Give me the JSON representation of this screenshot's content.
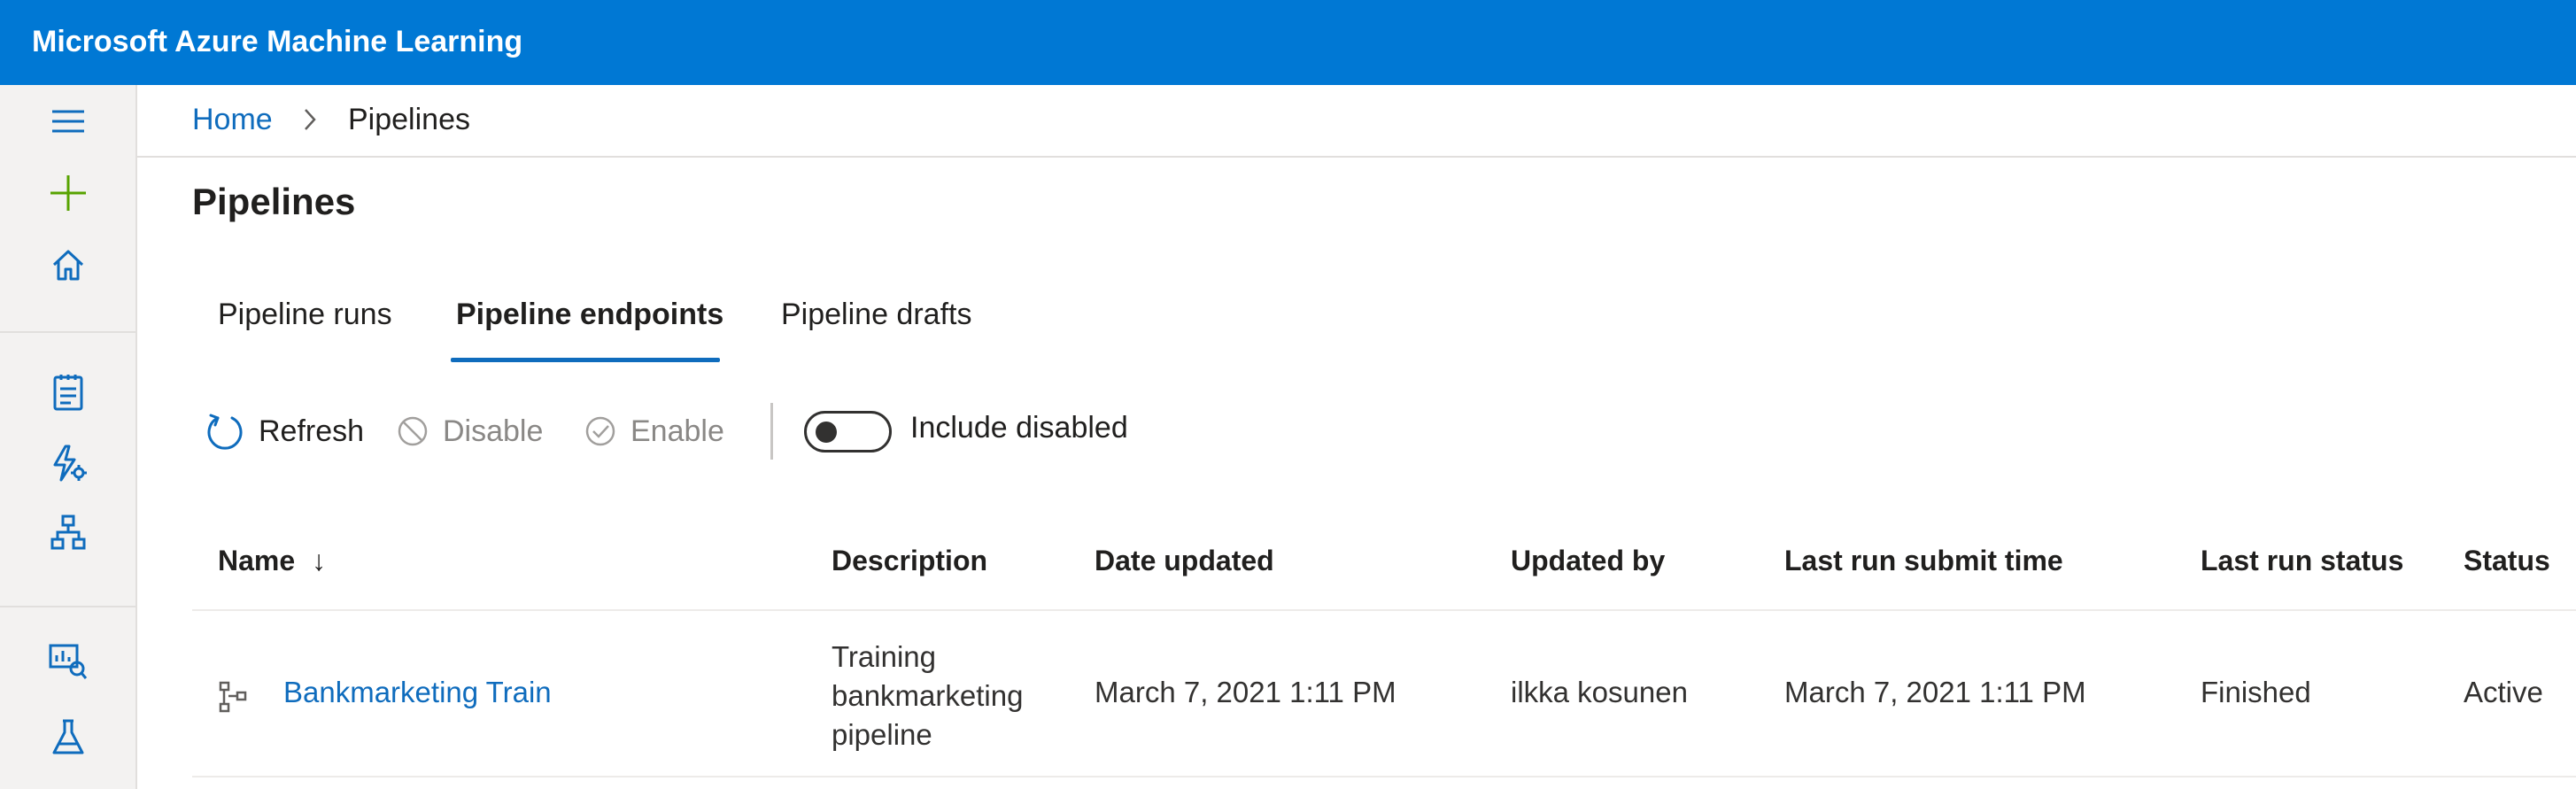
{
  "app": {
    "title": "Microsoft Azure Machine Learning"
  },
  "breadcrumb": {
    "home": "Home",
    "current": "Pipelines"
  },
  "page": {
    "title": "Pipelines"
  },
  "tabs": [
    {
      "label": "Pipeline runs",
      "selected": false
    },
    {
      "label": "Pipeline endpoints",
      "selected": true
    },
    {
      "label": "Pipeline drafts",
      "selected": false
    }
  ],
  "toolbar": {
    "refresh": "Refresh",
    "disable": "Disable",
    "enable": "Enable",
    "include_disabled": "Include disabled",
    "include_disabled_on": false
  },
  "table": {
    "columns": [
      "Name",
      "Description",
      "Date updated",
      "Updated by",
      "Last run submit time",
      "Last run status",
      "Status"
    ],
    "sort_indicator": "↓",
    "rows": [
      {
        "name": "Bankmarketing Train",
        "description": "Training bankmarketing pipeline",
        "date_updated": "March 7, 2021 1:11 PM",
        "updated_by": "ilkka kosunen",
        "last_run_submit_time": "March 7, 2021 1:11 PM",
        "last_run_status": "Finished",
        "status": "Active"
      }
    ]
  },
  "nav_icons": [
    "menu-icon",
    "add-icon",
    "home-icon",
    "notebook-icon",
    "automl-icon",
    "designer-icon",
    "datasets-icon",
    "experiments-icon"
  ],
  "colors": {
    "brand": "#0078d4",
    "link": "#0f6cbd",
    "add": "#57a300"
  }
}
